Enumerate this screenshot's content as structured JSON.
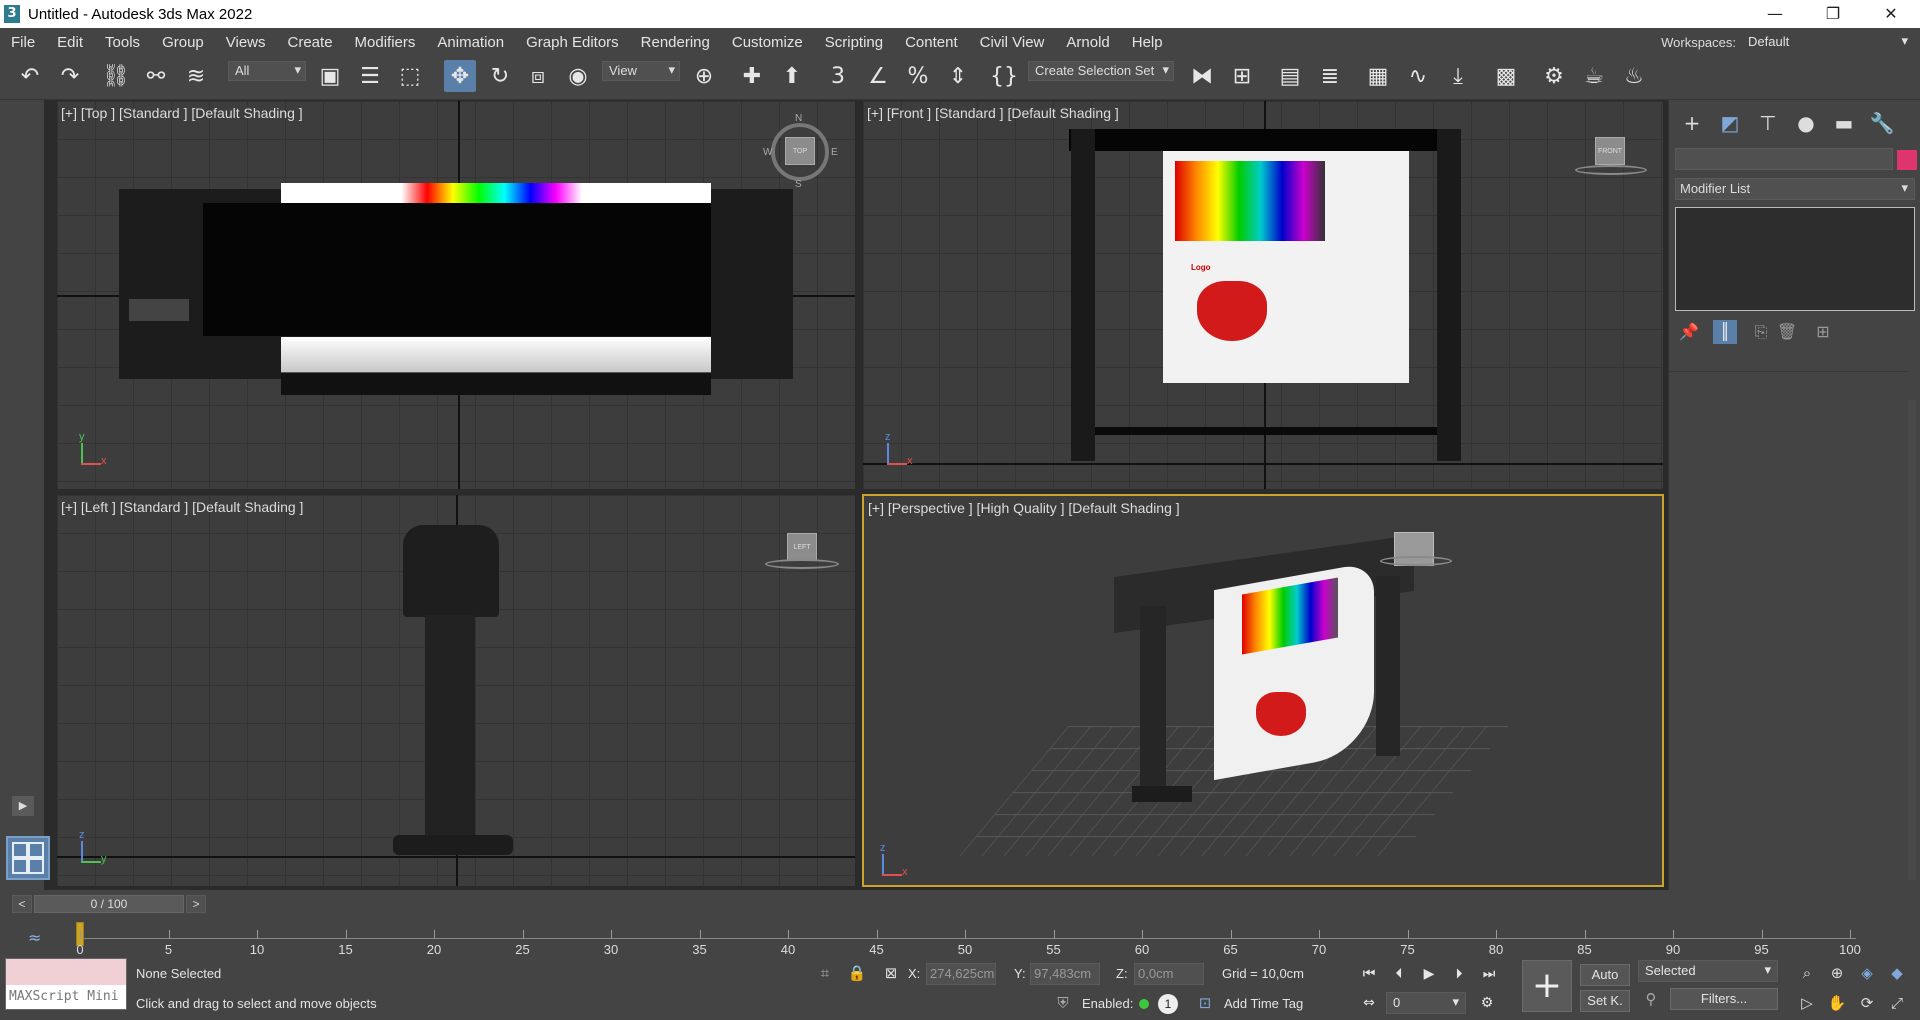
{
  "window": {
    "app_icon": "3",
    "title": "Untitled - Autodesk 3ds Max 2022",
    "minimize_icon": "minimize-icon",
    "maximize_icon": "restore-icon",
    "close_icon": "close-icon"
  },
  "menu": {
    "items": [
      "File",
      "Edit",
      "Tools",
      "Group",
      "Views",
      "Create",
      "Modifiers",
      "Animation",
      "Graph Editors",
      "Rendering",
      "Customize",
      "Scripting",
      "Content",
      "Civil View",
      "Arnold",
      "Help"
    ],
    "workspaces_label": "Workspaces:",
    "workspaces_value": "Default"
  },
  "toolbar": {
    "selection_filter": "All",
    "reference_coord": "View",
    "named_selection": "Create Selection Set",
    "icons": [
      "undo-icon",
      "redo-icon",
      "link-icon",
      "unlink-icon",
      "bind-space-warp-icon",
      "select-object-icon",
      "select-by-name-icon",
      "rectangular-selection-icon",
      "select-move-icon",
      "select-rotate-icon",
      "select-scale-icon",
      "select-place-icon",
      "pivot-icon",
      "select-manipulate-icon",
      "snap-toggle-icon",
      "angle-snap-icon",
      "percent-snap-icon",
      "spinner-snap-icon",
      "edit-named-selection-icon",
      "mirror-icon",
      "align-icon",
      "scene-explorer-icon",
      "layer-explorer-icon",
      "ribbon-icon",
      "curve-editor-icon",
      "schematic-view-icon",
      "material-editor-icon",
      "render-setup-icon",
      "rendered-frame-window-icon",
      "render-production-icon"
    ]
  },
  "viewports": {
    "top": {
      "label": "[+] [Top ] [Standard ] [Default Shading ]",
      "cube": "TOP",
      "compass": {
        "n": "N",
        "s": "S",
        "e": "E",
        "w": "W"
      }
    },
    "front": {
      "label": "[+] [Front ] [Standard ] [Default Shading ]",
      "cube": "FRONT"
    },
    "left": {
      "label": "[+] [Left ] [Standard ] [Default Shading ]",
      "cube": "LEFT"
    },
    "perspective": {
      "label": "[+] [Perspective ] [High Quality ] [Default Shading ]"
    },
    "paper_logo": "Logo",
    "axis": {
      "x": "x",
      "y": "y",
      "z": "z"
    }
  },
  "command_panel": {
    "tabs": [
      "create-icon",
      "modify-icon",
      "hierarchy-icon",
      "motion-icon",
      "display-icon",
      "utilities-icon"
    ],
    "modifier_list": "Modifier List",
    "swatch_color": "#e0346f",
    "stack_buttons": [
      "pin-stack-icon",
      "show-end-result-icon",
      "make-unique-icon",
      "remove-modifier-icon",
      "configure-modifier-sets-icon"
    ]
  },
  "time_slider": {
    "position": "0 / 100",
    "prev": "<",
    "next": ">",
    "ticks": [
      "0",
      "5",
      "10",
      "15",
      "20",
      "25",
      "30",
      "35",
      "40",
      "45",
      "50",
      "55",
      "60",
      "65",
      "70",
      "75",
      "80",
      "85",
      "90",
      "95",
      "100"
    ]
  },
  "status": {
    "maxscript_label": "MAXScript Mini",
    "selection": "None Selected",
    "prompt": "Click and drag to select and move objects",
    "x_label": "X:",
    "x_value": "274,625cm",
    "y_label": "Y:",
    "y_value": "97,483cm",
    "z_label": "Z:",
    "z_value": "0,0cm",
    "grid": "Grid = 10,0cm",
    "enabled_label": "Enabled:",
    "enabled_count": "1",
    "add_time_tag": "Add Time Tag",
    "auto_key": "Auto",
    "set_key": "Set K.",
    "key_mode": "Selected",
    "frame_value": "0",
    "filters": "Filters..."
  }
}
